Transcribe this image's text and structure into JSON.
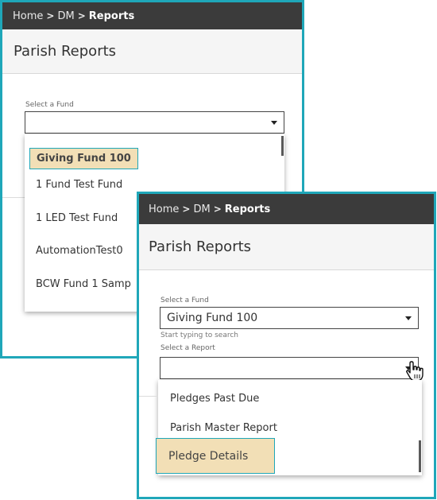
{
  "panel_a": {
    "breadcrumb": {
      "home": "Home",
      "dm": "DM",
      "current": "Reports"
    },
    "page_title": "Parish Reports",
    "fund_label": "Select a Fund",
    "fund_value": "",
    "fund_options": [
      "Giving Fund 100",
      "1 Fund Test Fund",
      "1 LED Test Fund",
      "AutomationTest0",
      "BCW Fund 1 Samp"
    ]
  },
  "panel_b": {
    "breadcrumb": {
      "home": "Home",
      "dm": "DM",
      "current": "Reports"
    },
    "page_title": "Parish Reports",
    "fund_label": "Select a Fund",
    "fund_value": "Giving Fund 100",
    "fund_hint": "Start typing to search",
    "report_label": "Select a Report",
    "report_value": "",
    "report_options": [
      "Pledges Past Due",
      "Parish Master Report",
      "Pledge Details"
    ]
  },
  "colors": {
    "accent": "#1fa7b9",
    "highlight": "#f2dfb6",
    "header": "#3b3b3b"
  }
}
